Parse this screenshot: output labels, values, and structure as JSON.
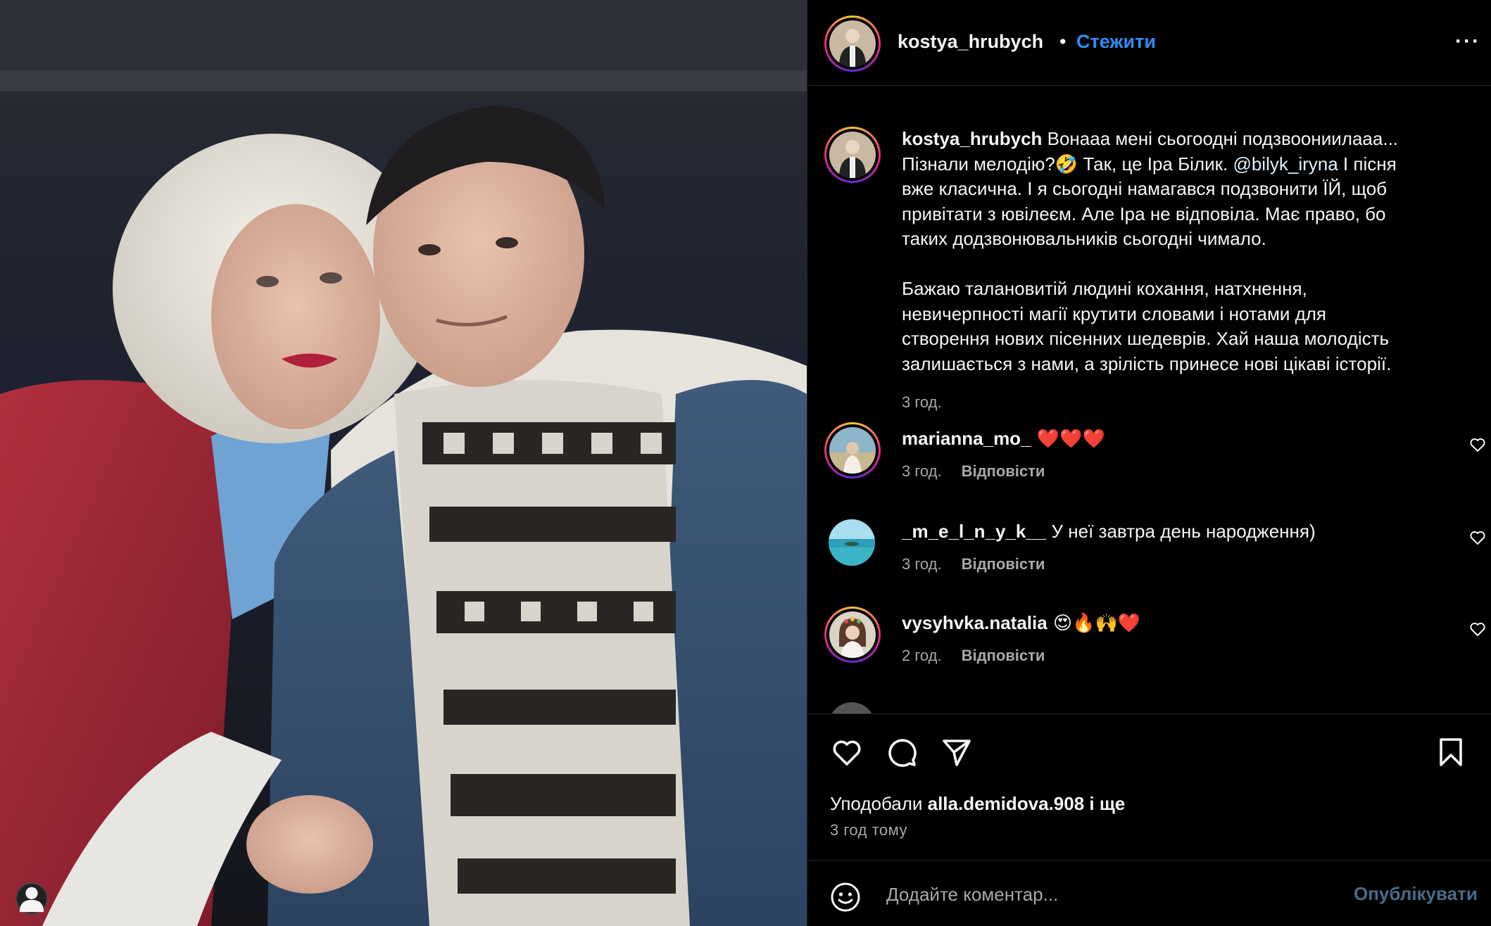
{
  "post": {
    "author": "kostya_hrubych",
    "separator": "•",
    "follow_label": "Стежити",
    "more_label": "···"
  },
  "caption": {
    "author": "kostya_hrubych",
    "line1": " Вонааа мені сьогоодні подзвоониилааа...",
    "line2a": "Пізнали мелодію?🤣 Так, це Іра Білик. ",
    "mention": "@bilyk_iryna",
    "line2b": " І пісня",
    "line3": "вже класична. І я сьогодні намагався подзвонити ЇЙ, щоб",
    "line4": "привітати з ювілеєм. Але Іра не відповіла. Має право, бо",
    "line5": "таких додзвонювальників сьогодні чимало.",
    "line6": "Бажаю талановитій людині кохання, натхнення,",
    "line7": "невичерпності магії крутити словами і нотами для",
    "line8": "створення нових пісенних шедеврів. Хай наша молодість",
    "line9": "залишається з нами, а зрілість принесе нові цікаві історії.",
    "time": "3 год."
  },
  "comments": [
    {
      "user": "marianna_mo_",
      "text": " ❤️❤️❤️",
      "time": "3 год.",
      "reply": "Відповісти"
    },
    {
      "user": "_m_e_l_n_y_k__",
      "text": " У неї завтра день народження)",
      "time": "3 год.",
      "reply": "Відповісти"
    },
    {
      "user": "vysyhvka.natalia",
      "text": " 😍🔥🙌❤️",
      "time": "2 год.",
      "reply": "Відповісти"
    }
  ],
  "likes": {
    "prefix": "Уподобали ",
    "user": "alla.demidova.908",
    "suffix": " і ще"
  },
  "post_time": "3 год тому",
  "add_comment": {
    "placeholder": "Додайте коментар...",
    "post_label": "Опублікувати"
  },
  "icons": {
    "like": "heart-icon",
    "comment": "comment-icon",
    "share": "paper-plane-icon",
    "save": "bookmark-icon",
    "emoji": "smiley-icon",
    "tag": "user-tag-icon"
  },
  "colors": {
    "link_blue": "#2f8df5",
    "muted": "#a8a8a8",
    "post_disabled": "#4a6b8a"
  }
}
